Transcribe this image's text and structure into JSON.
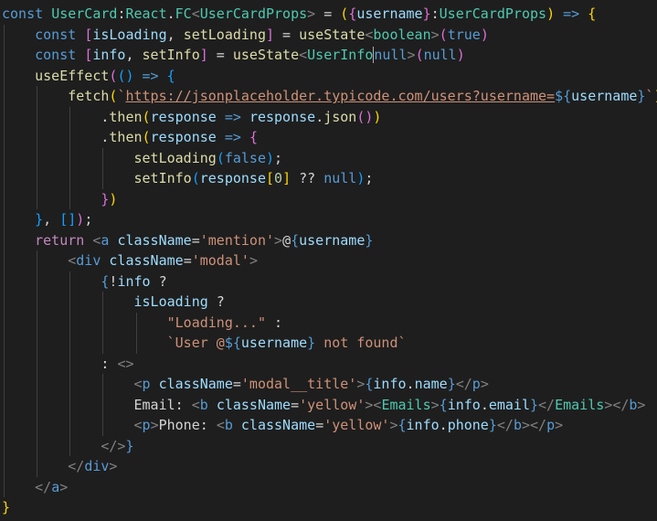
{
  "colors": {
    "background": "#1e1e1e",
    "default": "#d4d4d4",
    "keyword": "#569cd6",
    "control": "#c586c0",
    "type": "#4ec9b0",
    "func": "#dcdcaa",
    "var": "#9cdcfe",
    "string": "#ce9178",
    "number": "#b5cea8",
    "tag": "#808080",
    "brace1": "#ffd700",
    "brace2": "#da70d6",
    "brace3": "#179fff"
  },
  "code_lines": [
    [
      [
        "keyword",
        "const "
      ],
      [
        "type",
        "UserCard"
      ],
      [
        "default",
        ":"
      ],
      [
        "type",
        "React"
      ],
      [
        "default",
        "."
      ],
      [
        "type",
        "FC"
      ],
      [
        "tag",
        "<"
      ],
      [
        "type",
        "UserCardProps"
      ],
      [
        "tag",
        "> "
      ],
      [
        "default",
        "= "
      ],
      [
        "brace1",
        "("
      ],
      [
        "brace2",
        "{"
      ],
      [
        "var",
        "username"
      ],
      [
        "brace2",
        "}"
      ],
      [
        "default",
        ":"
      ],
      [
        "type",
        "UserCardProps"
      ],
      [
        "brace1",
        ")"
      ],
      [
        "default",
        " "
      ],
      [
        "keyword",
        "=>"
      ],
      [
        "default",
        " "
      ],
      [
        "brace1",
        "{"
      ]
    ],
    [
      [
        "default",
        "    "
      ],
      [
        "keyword",
        "const "
      ],
      [
        "brace2",
        "["
      ],
      [
        "var",
        "isLoading"
      ],
      [
        "default",
        ", "
      ],
      [
        "func",
        "setLoading"
      ],
      [
        "brace2",
        "]"
      ],
      [
        "default",
        " = "
      ],
      [
        "func",
        "useState"
      ],
      [
        "tag",
        "<"
      ],
      [
        "type",
        "boolean"
      ],
      [
        "tag",
        ">"
      ],
      [
        "brace2",
        "("
      ],
      [
        "keyword",
        "true"
      ],
      [
        "brace2",
        ")"
      ]
    ],
    [
      [
        "default",
        "    "
      ],
      [
        "keyword",
        "const "
      ],
      [
        "brace2",
        "["
      ],
      [
        "var",
        "info"
      ],
      [
        "default",
        ", "
      ],
      [
        "func",
        "setInfo"
      ],
      [
        "brace2",
        "]"
      ],
      [
        "default",
        " = "
      ],
      [
        "func",
        "useState"
      ],
      [
        "tag",
        "<"
      ],
      [
        "type",
        "UserInfo"
      ],
      [
        "cursor",
        "|"
      ],
      [
        "keyword",
        "null"
      ],
      [
        "tag",
        ">"
      ],
      [
        "brace2",
        "("
      ],
      [
        "keyword",
        "null"
      ],
      [
        "brace2",
        ")"
      ]
    ],
    [
      [
        "default",
        "    "
      ],
      [
        "func",
        "useEffect"
      ],
      [
        "brace2",
        "("
      ],
      [
        "brace3",
        "()"
      ],
      [
        "default",
        " "
      ],
      [
        "keyword",
        "=>"
      ],
      [
        "default",
        " "
      ],
      [
        "brace3",
        "{"
      ]
    ],
    [
      [
        "default",
        "        "
      ],
      [
        "func",
        "fetch"
      ],
      [
        "brace1",
        "("
      ],
      [
        "string",
        "`"
      ],
      [
        "url",
        "https://jsonplaceholder.typicode.com/users?username="
      ],
      [
        "keyword",
        "${"
      ],
      [
        "var",
        "username"
      ],
      [
        "keyword",
        "}"
      ],
      [
        "string",
        "`"
      ],
      [
        "brace1",
        ")"
      ]
    ],
    [
      [
        "default",
        "            ."
      ],
      [
        "func",
        "then"
      ],
      [
        "brace1",
        "("
      ],
      [
        "var",
        "response"
      ],
      [
        "default",
        " "
      ],
      [
        "keyword",
        "=>"
      ],
      [
        "default",
        " "
      ],
      [
        "var",
        "response"
      ],
      [
        "default",
        "."
      ],
      [
        "func",
        "json"
      ],
      [
        "brace2",
        "()"
      ],
      [
        "brace1",
        ")"
      ]
    ],
    [
      [
        "default",
        "            ."
      ],
      [
        "func",
        "then"
      ],
      [
        "brace1",
        "("
      ],
      [
        "var",
        "response"
      ],
      [
        "default",
        " "
      ],
      [
        "keyword",
        "=>"
      ],
      [
        "default",
        " "
      ],
      [
        "brace2",
        "{"
      ]
    ],
    [
      [
        "default",
        "                "
      ],
      [
        "func",
        "setLoading"
      ],
      [
        "brace3",
        "("
      ],
      [
        "keyword",
        "false"
      ],
      [
        "brace3",
        ")"
      ],
      [
        "default",
        ";"
      ]
    ],
    [
      [
        "default",
        "                "
      ],
      [
        "func",
        "setInfo"
      ],
      [
        "brace3",
        "("
      ],
      [
        "var",
        "response"
      ],
      [
        "brace1",
        "["
      ],
      [
        "number",
        "0"
      ],
      [
        "brace1",
        "]"
      ],
      [
        "default",
        " ?? "
      ],
      [
        "keyword",
        "null"
      ],
      [
        "brace3",
        ")"
      ],
      [
        "default",
        ";"
      ]
    ],
    [
      [
        "default",
        "            "
      ],
      [
        "brace2",
        "}"
      ],
      [
        "brace1",
        ")"
      ]
    ],
    [
      [
        "default",
        "    "
      ],
      [
        "brace3",
        "}"
      ],
      [
        "default",
        ", "
      ],
      [
        "brace3",
        "[]"
      ],
      [
        "brace2",
        ")"
      ],
      [
        "default",
        ";"
      ]
    ],
    [
      [
        "default",
        "    "
      ],
      [
        "control",
        "return "
      ],
      [
        "tag",
        "<"
      ],
      [
        "keyword",
        "a "
      ],
      [
        "var",
        "className"
      ],
      [
        "default",
        "="
      ],
      [
        "string",
        "'mention'"
      ],
      [
        "tag",
        ">"
      ],
      [
        "default",
        "@"
      ],
      [
        "keyword",
        "{"
      ],
      [
        "var",
        "username"
      ],
      [
        "keyword",
        "}"
      ]
    ],
    [
      [
        "default",
        "        "
      ],
      [
        "tag",
        "<"
      ],
      [
        "keyword",
        "div "
      ],
      [
        "var",
        "className"
      ],
      [
        "default",
        "="
      ],
      [
        "string",
        "'modal'"
      ],
      [
        "tag",
        ">"
      ]
    ],
    [
      [
        "default",
        "            "
      ],
      [
        "keyword",
        "{"
      ],
      [
        "default",
        "!"
      ],
      [
        "var",
        "info"
      ],
      [
        "default",
        " ?"
      ]
    ],
    [
      [
        "default",
        "                "
      ],
      [
        "var",
        "isLoading"
      ],
      [
        "default",
        " ?"
      ]
    ],
    [
      [
        "default",
        "                    "
      ],
      [
        "string",
        "\"Loading...\""
      ],
      [
        "default",
        " :"
      ]
    ],
    [
      [
        "default",
        "                    "
      ],
      [
        "string",
        "`User @"
      ],
      [
        "keyword",
        "${"
      ],
      [
        "var",
        "username"
      ],
      [
        "keyword",
        "}"
      ],
      [
        "string",
        " not found`"
      ]
    ],
    [
      [
        "default",
        "            : "
      ],
      [
        "tag",
        "<>"
      ]
    ],
    [
      [
        "default",
        "                "
      ],
      [
        "tag",
        "<"
      ],
      [
        "keyword",
        "p "
      ],
      [
        "var",
        "className"
      ],
      [
        "default",
        "="
      ],
      [
        "string",
        "'modal__title'"
      ],
      [
        "tag",
        ">"
      ],
      [
        "keyword",
        "{"
      ],
      [
        "var",
        "info"
      ],
      [
        "default",
        "."
      ],
      [
        "var",
        "name"
      ],
      [
        "keyword",
        "}"
      ],
      [
        "tag",
        "</"
      ],
      [
        "keyword",
        "p"
      ],
      [
        "tag",
        ">"
      ]
    ],
    [
      [
        "default",
        "                Email: "
      ],
      [
        "tag",
        "<"
      ],
      [
        "keyword",
        "b "
      ],
      [
        "var",
        "className"
      ],
      [
        "default",
        "="
      ],
      [
        "string",
        "'yellow'"
      ],
      [
        "tag",
        ">"
      ],
      [
        "tag",
        "<"
      ],
      [
        "type",
        "Emails"
      ],
      [
        "tag",
        ">"
      ],
      [
        "keyword",
        "{"
      ],
      [
        "var",
        "info"
      ],
      [
        "default",
        "."
      ],
      [
        "var",
        "email"
      ],
      [
        "keyword",
        "}"
      ],
      [
        "tag",
        "</"
      ],
      [
        "type",
        "Emails"
      ],
      [
        "tag",
        ">"
      ],
      [
        "tag",
        "</"
      ],
      [
        "keyword",
        "b"
      ],
      [
        "tag",
        ">"
      ]
    ],
    [
      [
        "default",
        "                "
      ],
      [
        "tag",
        "<"
      ],
      [
        "keyword",
        "p"
      ],
      [
        "tag",
        ">"
      ],
      [
        "default",
        "Phone: "
      ],
      [
        "tag",
        "<"
      ],
      [
        "keyword",
        "b "
      ],
      [
        "var",
        "className"
      ],
      [
        "default",
        "="
      ],
      [
        "string",
        "'yellow'"
      ],
      [
        "tag",
        ">"
      ],
      [
        "keyword",
        "{"
      ],
      [
        "var",
        "info"
      ],
      [
        "default",
        "."
      ],
      [
        "var",
        "phone"
      ],
      [
        "keyword",
        "}"
      ],
      [
        "tag",
        "</"
      ],
      [
        "keyword",
        "b"
      ],
      [
        "tag",
        "></"
      ],
      [
        "keyword",
        "p"
      ],
      [
        "tag",
        ">"
      ]
    ],
    [
      [
        "default",
        "            "
      ],
      [
        "tag",
        "</>"
      ],
      [
        "keyword",
        "}"
      ]
    ],
    [
      [
        "default",
        "        "
      ],
      [
        "tag",
        "</"
      ],
      [
        "keyword",
        "div"
      ],
      [
        "tag",
        ">"
      ]
    ],
    [
      [
        "default",
        "    "
      ],
      [
        "tag",
        "</"
      ],
      [
        "keyword",
        "a"
      ],
      [
        "tag",
        ">"
      ]
    ],
    [
      [
        "brace1",
        "}"
      ]
    ]
  ]
}
